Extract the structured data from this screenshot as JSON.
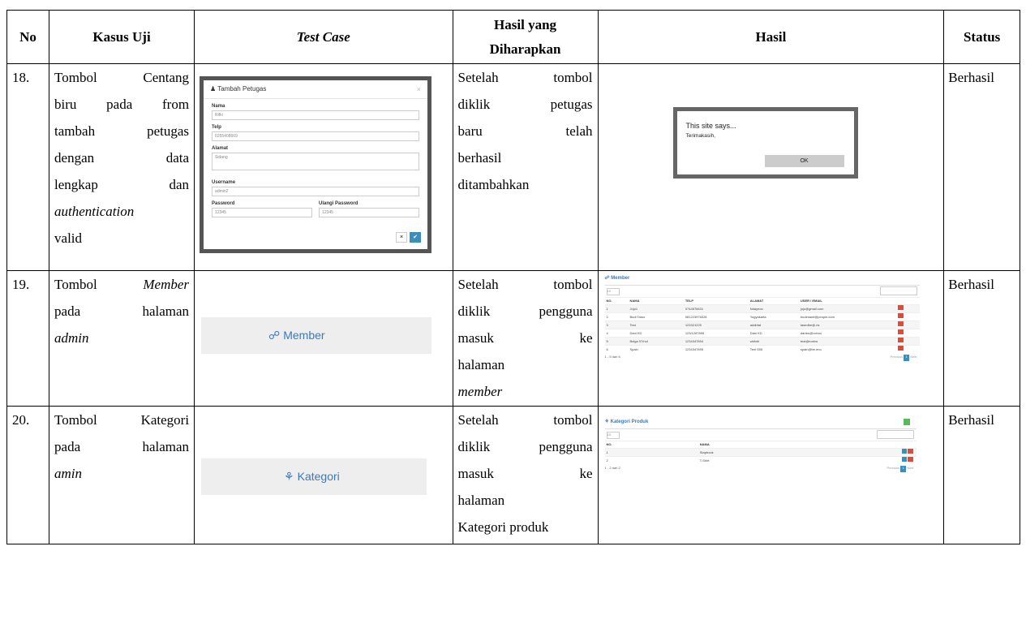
{
  "headers": {
    "no": "No",
    "kasus": "Kasus Uji",
    "test_case": "Test Case",
    "hasil_diharapkan_1": "Hasil yang",
    "hasil_diharapkan_2": "Diharapkan",
    "hasil": "Hasil",
    "status": "Status"
  },
  "rows": [
    {
      "no": "18.",
      "kasus": {
        "l1": "Tombol Centang",
        "l2": "biru pada from",
        "l3": "tambah petugas",
        "l4": "dengan data",
        "l5": "lengkap dan",
        "l6": "authentication",
        "l7": "valid"
      },
      "expected": {
        "l1": "Setelah tombol",
        "l2": "diklik petugas",
        "l3": "baru telah",
        "l4": "berhasil",
        "l5": "ditambahkan"
      },
      "status": "Berhasil",
      "test_modal": {
        "title": "Tambah Petugas",
        "close": "×",
        "nama_label": "Nama",
        "nama_value": "Rifki",
        "telp_label": "Telp",
        "telp_value": "0255408669",
        "alamat_label": "Alamat",
        "alamat_value": "Sidang",
        "username_label": "Username",
        "username_value": "admin2",
        "password_label": "Password",
        "password_value": "12345",
        "ulangi_label": "Ulangi Password",
        "ulangi_value": "12345",
        "cancel": "×",
        "ok": "✔"
      },
      "result_alert": {
        "title": "This site says...",
        "message": "Terimakasih,",
        "ok": "OK"
      }
    },
    {
      "no": "19.",
      "kasus": {
        "l1a": "Tombol ",
        "l1b": "Member",
        "l2": "pada halaman",
        "l3": "admin"
      },
      "expected": {
        "l1": "Setelah tombol",
        "l2": "diklik pengguna",
        "l3": "masuk ke",
        "l4": "halaman",
        "l5": "member"
      },
      "status": "Berhasil",
      "button_label": "Member",
      "result_table": {
        "title": "Member",
        "select": "10",
        "columns": [
          "NO.",
          "NAMA",
          "TELP",
          "ALAMAT",
          "USER / EMAIL"
        ],
        "rows": [
          [
            "1",
            "Jojo1",
            "0744576631",
            "Ndayeon",
            "jojo@gmail.com"
          ],
          [
            "2",
            "Budi Tatoo",
            "081223976026",
            "Yogyakarta",
            "budimanit@people.com"
          ],
          [
            "3",
            "Test",
            "123321225",
            "addbfaf",
            "tasedbe@.nk"
          ],
          [
            "4",
            "Dani KD",
            "123/1287895",
            "Dani KD",
            "dantro@ocbox"
          ],
          [
            "5",
            "Bolga 57/nol",
            "1234347894",
            "wbfvbl",
            "test@eorins"
          ],
          [
            "6",
            "Spain",
            "1234347895",
            "Tent 555",
            "spain@be.eno"
          ]
        ],
        "info": "1 - 5 dari 6",
        "prev": "Previous",
        "page": "1",
        "next": "Next"
      }
    },
    {
      "no": "20.",
      "kasus": {
        "l1": "Tombol Kategori",
        "l2": "pada halaman",
        "l3": "amin"
      },
      "expected": {
        "l1": "Setelah tombol",
        "l2": "diklik pengguna",
        "l3": "masuk ke",
        "l4": "halaman",
        "l5": "Kategori produk"
      },
      "status": "Berhasil",
      "button_label": "Kategori",
      "result_table": {
        "title": "Kategori Produk",
        "select": "10",
        "columns": [
          "NO.",
          "NAMA"
        ],
        "rows": [
          [
            "1",
            "Stapbook"
          ],
          [
            "2",
            "T-Shirt"
          ]
        ],
        "info": "1 - 2 dari 2",
        "prev": "Previous",
        "page": "1",
        "next": "Next"
      }
    }
  ]
}
